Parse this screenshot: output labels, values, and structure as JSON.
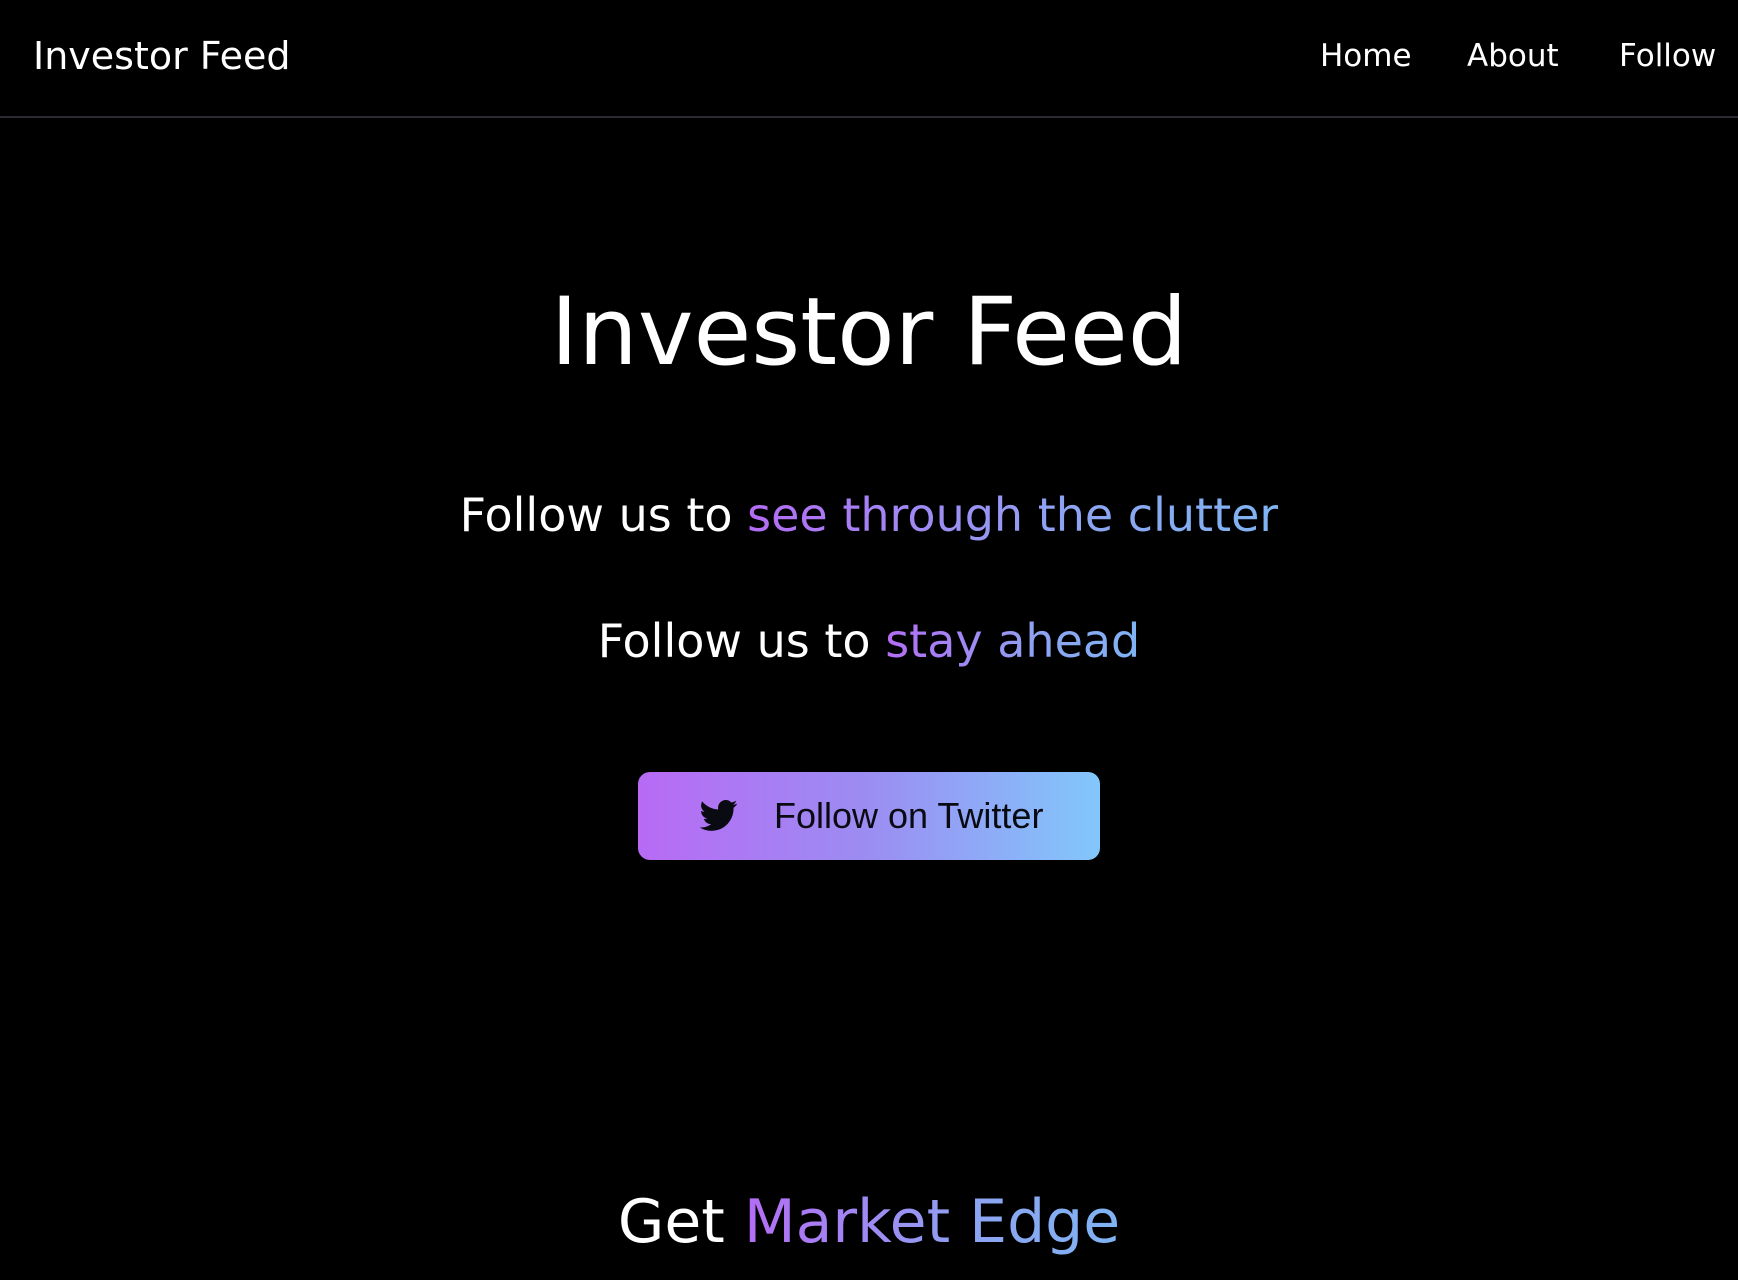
{
  "navbar": {
    "brand": "Investor Feed",
    "links": [
      {
        "label": "Home"
      },
      {
        "label": "About"
      },
      {
        "label": "Follow"
      }
    ]
  },
  "hero": {
    "title": "Investor Feed",
    "taglines": [
      {
        "prefix": "Follow us to ",
        "highlight": "see through the clutter"
      },
      {
        "prefix": "Follow us to ",
        "highlight": "stay ahead"
      }
    ],
    "cta": {
      "label": "Follow on Twitter",
      "icon": "twitter-bird-icon"
    }
  },
  "section": {
    "heading_prefix": "Get ",
    "heading_highlight": "Market Edge"
  },
  "colors": {
    "background": "#000000",
    "text": "#ffffff",
    "gradient_start": "#b86af4",
    "gradient_end": "#82c7fb",
    "divider": "#2a2a33"
  }
}
